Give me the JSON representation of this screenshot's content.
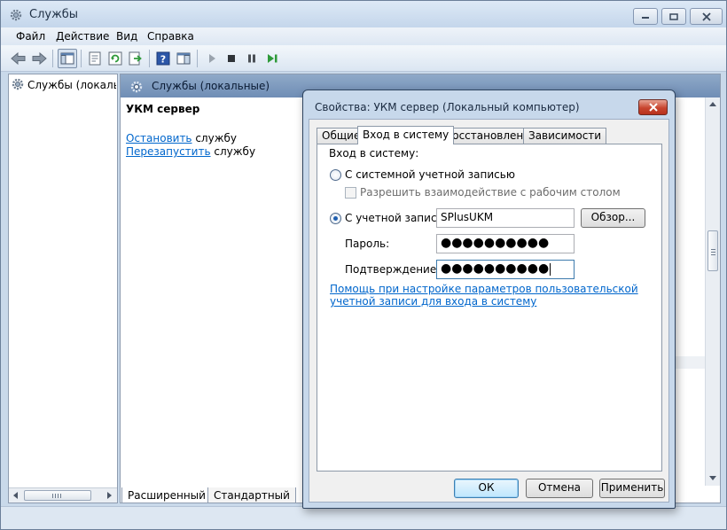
{
  "window": {
    "title": "Службы"
  },
  "menu": {
    "items": [
      "Файл",
      "Действие",
      "Вид",
      "Справка"
    ]
  },
  "toolbar": {
    "icons": [
      "back-arrow-icon",
      "forward-arrow-icon",
      "show-hide-console-tree-icon",
      "properties-icon",
      "refresh-icon",
      "export-list-icon",
      "help-icon",
      "show-action-pane-icon",
      "play-icon",
      "stop-icon",
      "pause-icon",
      "restart-icon"
    ]
  },
  "tree": {
    "root_label": "Службы (локальн"
  },
  "main": {
    "header_title": "Службы (локальные)",
    "service_name": "УКМ сервер",
    "stop_link": "Остановить",
    "stop_suffix": " службу",
    "restart_link": "Перезапустить",
    "restart_suffix": " службу",
    "tabs": [
      "Расширенный",
      "Стандартный"
    ]
  },
  "dialog": {
    "title": "Свойства: УКМ сервер (Локальный компьютер)",
    "tabs": [
      "Общие",
      "Вход в систему",
      "Восстановление",
      "Зависимости"
    ],
    "active_tab": "Вход в систему",
    "logon_heading": "Вход в систему:",
    "system_account_label": "С системной учетной записью",
    "interact_desktop_label": "Разрешить взаимодействие с рабочим столом",
    "this_account_label": "С учетной записью:",
    "account_value": "SPlusUKM",
    "browse_label": "Обзор...",
    "password_label": "Пароль:",
    "password_value": "●●●●●●●●●●",
    "confirm_label": "Подтверждение:",
    "confirm_value": "●●●●●●●●●●",
    "help_link": "Помощь при настройке параметров пользовательской учетной записи для входа в систему",
    "ok_label": "ОК",
    "cancel_label": "Отмена",
    "apply_label": "Применить"
  },
  "colors": {
    "link": "#0066cc",
    "pane_header": "#7f9bc0",
    "dialog_frame": "#c7d8eb",
    "close_button": "#c8452f"
  }
}
